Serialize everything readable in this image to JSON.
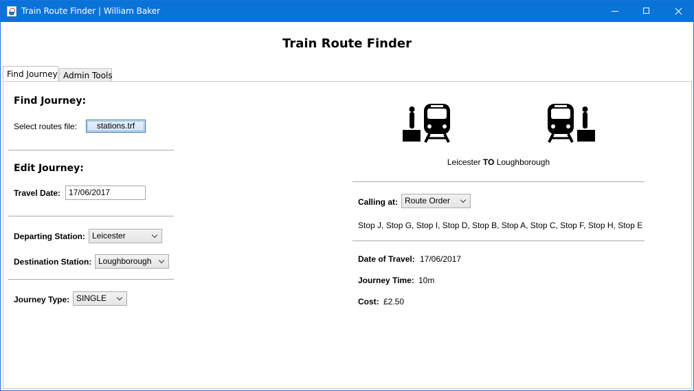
{
  "window": {
    "title": "Train Route Finder | William Baker"
  },
  "header": {
    "title": "Train Route Finder"
  },
  "tabs": [
    {
      "label": "Find Journey",
      "active": true
    },
    {
      "label": "Admin Tools",
      "active": false
    }
  ],
  "find": {
    "heading": "Find Journey:",
    "routes_label": "Select routes file:",
    "routes_button": "stations.trf"
  },
  "edit": {
    "heading": "Edit Journey:",
    "date_label": "Travel Date:",
    "date_value": "17/06/2017",
    "departing_label": "Departing Station:",
    "departing_value": "Leicester",
    "destination_label": "Destination Station:",
    "destination_value": "Loughborough",
    "type_label": "Journey Type:",
    "type_value": "SINGLE"
  },
  "summary": {
    "from": "Leicester",
    "to_word": "TO",
    "to": "Loughborough",
    "calling_label": "Calling at:",
    "calling_order": "Route Order",
    "stops": "Stop J, Stop G, Stop I, Stop D, Stop B, Stop A, Stop C, Stop F, Stop H, Stop E",
    "date_label": "Date of Travel:",
    "date_value": "17/06/2017",
    "time_label": "Journey Time:",
    "time_value": "10m",
    "cost_label": "Cost:",
    "cost_value": "£2.50"
  },
  "icons": {
    "app": "java-app-icon",
    "departure": "train-with-passenger-icon",
    "arrival": "train-with-passenger-icon"
  },
  "colors": {
    "titlebar": "#0a73d8",
    "accent_button": "#cfe3f7"
  }
}
